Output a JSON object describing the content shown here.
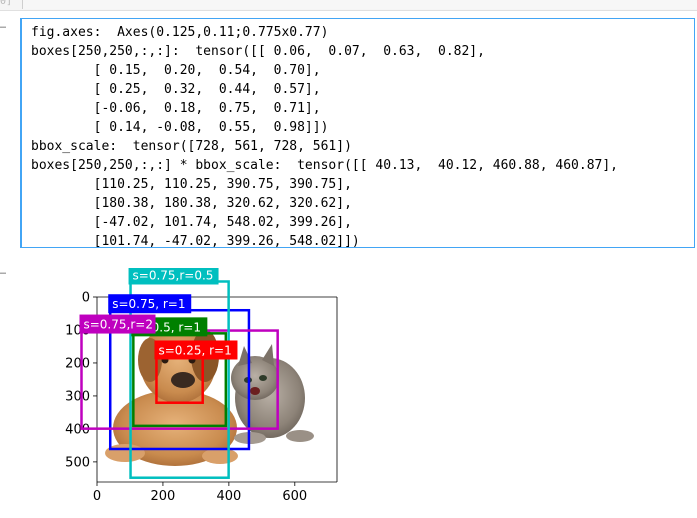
{
  "cell_prompt_fragment": "0]",
  "output_text": {
    "lines": [
      "fig.axes:  Axes(0.125,0.11;0.775x0.77)",
      "boxes[250,250,:,:]:  tensor([[ 0.06,  0.07,  0.63,  0.82],",
      "        [ 0.15,  0.20,  0.54,  0.70],",
      "        [ 0.25,  0.32,  0.44,  0.57],",
      "        [-0.06,  0.18,  0.75,  0.71],",
      "        [ 0.14, -0.08,  0.55,  0.98]])",
      "bbox_scale:  tensor([728, 561, 728, 561])",
      "boxes[250,250,:,:] * bbox_scale:  tensor([[ 40.13,  40.12, 460.88, 460.87],",
      "        [110.25, 110.25, 390.75, 390.75],",
      "        [180.38, 180.38, 320.62, 320.62],",
      "        [-47.02, 101.74, 548.02, 399.26],",
      "        [101.74, -47.02, 399.26, 548.02]])"
    ]
  },
  "ellipsis_1": "…",
  "ellipsis_2": "…",
  "chart_data": {
    "type": "image-with-bounding-boxes",
    "image_size": [
      728,
      561
    ],
    "xlim": [
      0,
      728
    ],
    "ylim": [
      561,
      0
    ],
    "xticks": [
      0,
      200,
      400,
      600
    ],
    "yticks": [
      0,
      100,
      200,
      300,
      400,
      500
    ],
    "xtick_labels": [
      "0",
      "200",
      "400",
      "600"
    ],
    "ytick_labels": [
      "0",
      "100",
      "200",
      "300",
      "400",
      "500"
    ],
    "boxes": [
      {
        "label": "s=0.75, r=1",
        "color": "#0000ff",
        "x1": 40.13,
        "y1": 40.12,
        "x2": 460.88,
        "y2": 460.87
      },
      {
        "label": "s=0.5, r=1",
        "color": "#008000",
        "x1": 110.25,
        "y1": 110.25,
        "x2": 390.75,
        "y2": 390.75
      },
      {
        "label": "s=0.25, r=1",
        "color": "#ff0000",
        "x1": 180.38,
        "y1": 180.38,
        "x2": 320.62,
        "y2": 320.62
      },
      {
        "label": "s=0.75,r=2",
        "color": "#bf00bf",
        "x1": -47.02,
        "y1": 101.74,
        "x2": 548.02,
        "y2": 399.26
      },
      {
        "label": "s=0.75,r=0.5",
        "color": "#00bfbf",
        "x1": 101.74,
        "y1": -47.02,
        "x2": 399.26,
        "y2": 548.02
      }
    ],
    "image_description_icons": [
      "dog-icon",
      "cat-icon"
    ]
  }
}
